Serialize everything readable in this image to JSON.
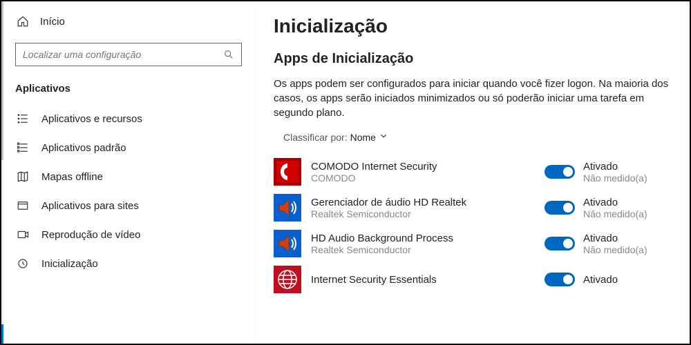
{
  "sidebar": {
    "home": "Início",
    "search_placeholder": "Localizar uma configuração",
    "category": "Aplicativos",
    "items": [
      {
        "label": "Aplicativos e recursos"
      },
      {
        "label": "Aplicativos padrão"
      },
      {
        "label": "Mapas offline"
      },
      {
        "label": "Aplicativos para sites"
      },
      {
        "label": "Reprodução de vídeo"
      },
      {
        "label": "Inicialização"
      }
    ]
  },
  "main": {
    "title": "Inicialização",
    "section_title": "Apps de Inicialização",
    "description": "Os apps podem ser configurados para iniciar quando você fizer logon. Na maioria dos casos, os apps serão iniciados minimizados ou só poderão iniciar uma tarefa em segundo plano.",
    "sort_label": "Classificar por:",
    "sort_value": "Nome",
    "apps": [
      {
        "name": "COMODO Internet Security",
        "publisher": "COMODO",
        "status": "Ativado",
        "impact": "Não medido(a)",
        "icon": "comodo"
      },
      {
        "name": "Gerenciador de áudio HD Realtek",
        "publisher": "Realtek Semiconductor",
        "status": "Ativado",
        "impact": "Não medido(a)",
        "icon": "speaker"
      },
      {
        "name": "HD Audio Background Process",
        "publisher": "Realtek Semiconductor",
        "status": "Ativado",
        "impact": "Não medido(a)",
        "icon": "speaker"
      },
      {
        "name": "Internet Security Essentials",
        "publisher": "",
        "status": "Ativado",
        "impact": "",
        "icon": "globe"
      }
    ]
  }
}
